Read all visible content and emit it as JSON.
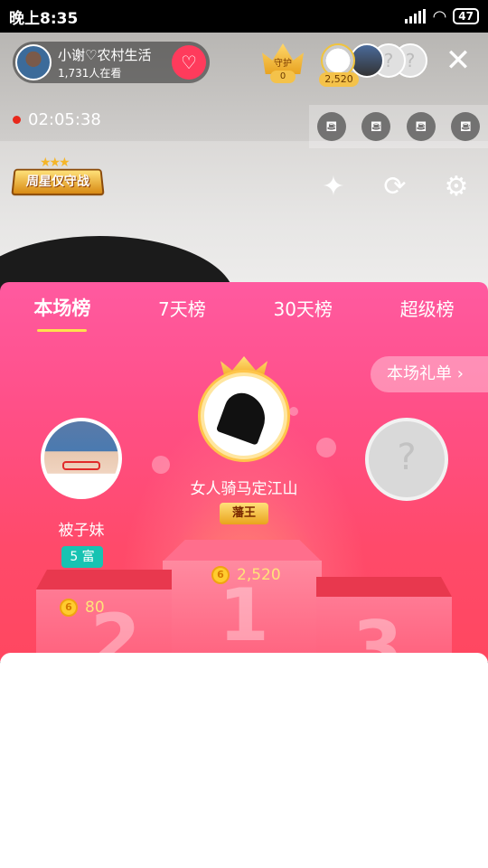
{
  "status_bar": {
    "time": "晚上8:35",
    "battery": "47"
  },
  "host": {
    "name": "小谢♡农村生活",
    "viewers": "1,731人在看"
  },
  "guard": {
    "label": "守护",
    "count": "0"
  },
  "top_gift_coins": "2,520",
  "live_timer": "02:05:38",
  "week_star_label": "周星仅守战",
  "ranking": {
    "tabs": [
      "本场榜",
      "7天榜",
      "30天榜",
      "超级榜"
    ],
    "active_tab": 0,
    "gift_list_label": "本场礼单",
    "first": {
      "name": "女人骑马定江山",
      "badge": "藩王",
      "coins": "2,520",
      "place": "1"
    },
    "second": {
      "name": "被子妹",
      "badge": "5 富",
      "coins": "80",
      "place": "2"
    },
    "third": {
      "place": "3"
    }
  },
  "colors": {
    "accent": "#ff4f86",
    "gold": "#f4c24a",
    "teal": "#17c3b2"
  }
}
